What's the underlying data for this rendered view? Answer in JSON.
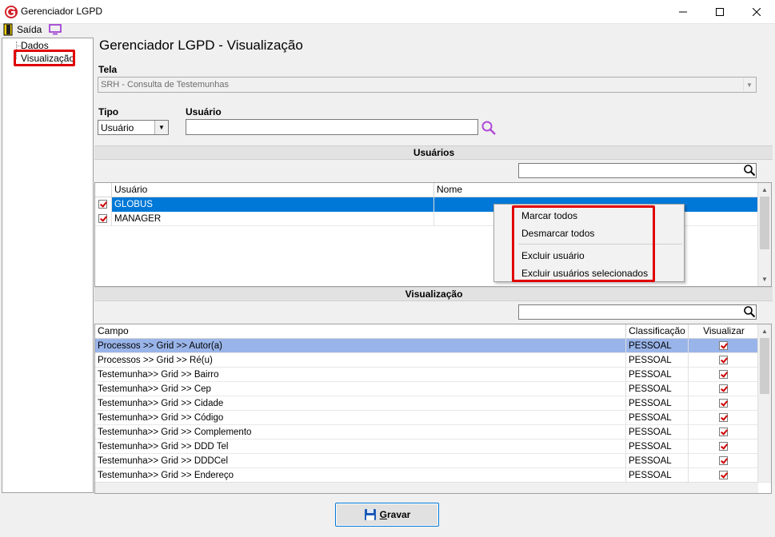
{
  "window": {
    "title": "Gerenciador LGPD"
  },
  "menu": {
    "exit_label": "Saída"
  },
  "tree": {
    "items": [
      {
        "label": "Dados"
      },
      {
        "label": "Visualização"
      }
    ]
  },
  "page": {
    "title": "Gerenciador LGPD - Visualização",
    "tela_label": "Tela",
    "tela_value": "SRH - Consulta de Testemunhas",
    "tipo_label": "Tipo",
    "tipo_value": "Usuário",
    "usuario_label": "Usuário",
    "usuario_value": ""
  },
  "usuarios": {
    "section_title": "Usuários",
    "search_value": "",
    "columns": [
      "Usuário",
      "Nome"
    ],
    "rows": [
      {
        "usuario": "GLOBUS",
        "nome": "",
        "checked": true,
        "selected": true
      },
      {
        "usuario": "MANAGER",
        "nome": "",
        "checked": true,
        "selected": false
      }
    ]
  },
  "context_menu": {
    "items": [
      "Marcar todos",
      "Desmarcar todos",
      "Excluir usuário",
      "Excluir usuários selecionados"
    ]
  },
  "visualizacao": {
    "section_title": "Visualização",
    "search_value": "",
    "columns": [
      "Campo",
      "Classificação",
      "Visualizar"
    ],
    "rows": [
      {
        "campo": "Processos >> Grid >> Autor(a)",
        "classificacao": "PESSOAL",
        "visualizar": true,
        "selected": true
      },
      {
        "campo": "Processos >> Grid >> Ré(u)",
        "classificacao": "PESSOAL",
        "visualizar": true
      },
      {
        "campo": "Testemunha>> Grid >> Bairro",
        "classificacao": "PESSOAL",
        "visualizar": true
      },
      {
        "campo": "Testemunha>> Grid >> Cep",
        "classificacao": "PESSOAL",
        "visualizar": true
      },
      {
        "campo": "Testemunha>> Grid >> Cidade",
        "classificacao": "PESSOAL",
        "visualizar": true
      },
      {
        "campo": "Testemunha>> Grid >> Código",
        "classificacao": "PESSOAL",
        "visualizar": true
      },
      {
        "campo": "Testemunha>> Grid >> Complemento",
        "classificacao": "PESSOAL",
        "visualizar": true
      },
      {
        "campo": "Testemunha>> Grid >> DDD Tel",
        "classificacao": "PESSOAL",
        "visualizar": true
      },
      {
        "campo": "Testemunha>> Grid >> DDDCel",
        "classificacao": "PESSOAL",
        "visualizar": true
      },
      {
        "campo": "Testemunha>> Grid >> Endereço",
        "classificacao": "PESSOAL",
        "visualizar": true
      }
    ]
  },
  "footer": {
    "save_label": "Gravar",
    "save_accel": "G",
    "save_rest": "ravar"
  },
  "colors": {
    "selection": "#0078d7",
    "selection_light": "#99b4e8",
    "highlight_border": "#e00000",
    "check_mark": "#d00000"
  }
}
